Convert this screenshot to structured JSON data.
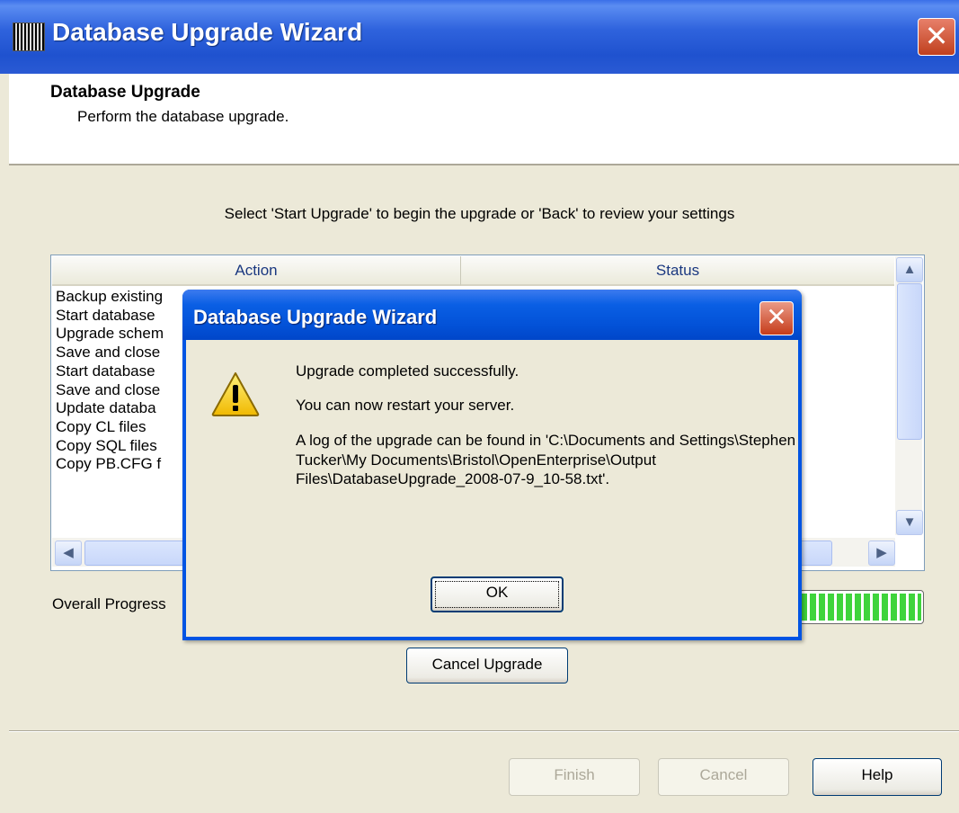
{
  "window": {
    "title": "Database Upgrade Wizard",
    "close_glyph": "✕"
  },
  "header": {
    "title": "Database Upgrade",
    "subtitle": "Perform the database upgrade."
  },
  "instruction": "Select 'Start Upgrade' to begin the upgrade or 'Back' to review your settings",
  "list": {
    "columns": [
      "Action",
      "Status"
    ],
    "rows": [
      "Backup existing",
      "Start database",
      "Upgrade schem",
      "Save and close",
      "Start database",
      "Save and close",
      "Update databa",
      "Copy CL files",
      "Copy SQL files",
      "Copy PB.CFG f"
    ]
  },
  "progress": {
    "label": "Overall Progress",
    "fraction": 1.0
  },
  "buttons": {
    "cancel_upgrade": "Cancel Upgrade",
    "finish": "Finish",
    "cancel": "Cancel",
    "help": "Help"
  },
  "dialog": {
    "title": "Database Upgrade Wizard",
    "icon": "warning-icon",
    "line1": "Upgrade completed successfully.",
    "line2": "You can now restart your server.",
    "line3": "A log of the upgrade can be found in 'C:\\Documents and Settings\\Stephen Tucker\\My Documents\\Bristol\\OpenEnterprise\\Output Files\\DatabaseUpgrade_2008-07-9_10-58.txt'.",
    "ok": "OK",
    "close_glyph": "✕"
  },
  "colors": {
    "titlebar": "#0054e3",
    "progress": "#3fd43c",
    "face": "#ece9d8"
  }
}
